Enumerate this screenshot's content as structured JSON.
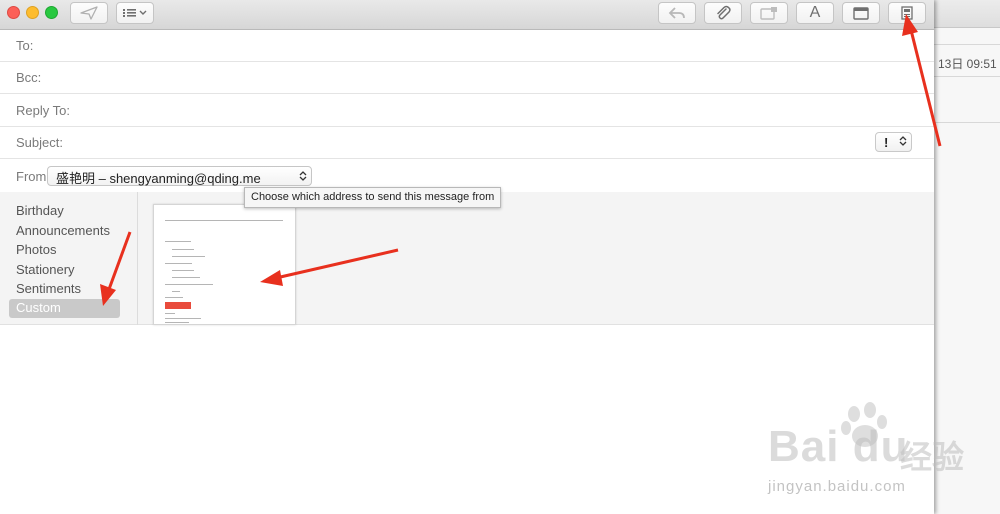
{
  "background_window": {
    "date_text": "13日 09:51"
  },
  "toolbar": {
    "icons": [
      "send-icon",
      "list-format-icon",
      "reply-icon",
      "attachment-icon",
      "photo-browser-icon",
      "font-icon",
      "window-icon",
      "stationery-icon"
    ],
    "font_button_label": "A"
  },
  "headers": {
    "to_label": "To:",
    "bcc_label": "Bcc:",
    "reply_to_label": "Reply To:",
    "subject_label": "Subject:",
    "priority_value": "!",
    "from_label": "From:",
    "from_value": "盛艳明 – shengyanming@qding.me"
  },
  "tooltip": {
    "text": "Choose which address to send this message from"
  },
  "stationery": {
    "categories": [
      "Birthday",
      "Announcements",
      "Photos",
      "Stationery",
      "Sentiments",
      "Custom"
    ],
    "selected_category": "Custom"
  },
  "watermark": {
    "brand": "Bai du",
    "brand_cn": "经验",
    "site": "jingyan.baidu.com"
  },
  "colors": {
    "annotation_arrow": "#e8301e",
    "traffic_red": "#fc5f57",
    "traffic_yellow": "#fdbc2e",
    "traffic_green": "#28c840",
    "selected_category_bg": "#c9c9c9"
  }
}
